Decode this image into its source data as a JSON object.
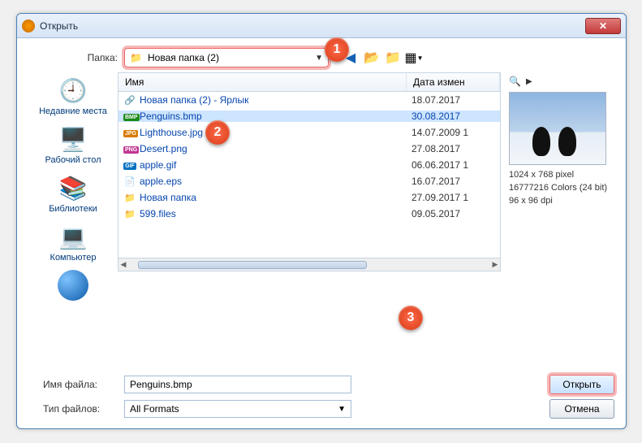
{
  "window": {
    "title": "Открыть"
  },
  "folder": {
    "label": "Папка:",
    "value": "Новая папка (2)"
  },
  "nav_icons": {
    "back": "back-icon",
    "up": "up-icon",
    "newfolder": "new-folder-icon",
    "views": "views-icon"
  },
  "places": [
    {
      "label": "Недавние места",
      "key": "recent"
    },
    {
      "label": "Рабочий стол",
      "key": "desktop"
    },
    {
      "label": "Библиотеки",
      "key": "libraries"
    },
    {
      "label": "Компьютер",
      "key": "computer"
    },
    {
      "label": "",
      "key": "network"
    }
  ],
  "columns": {
    "name": "Имя",
    "date": "Дата измен"
  },
  "files": [
    {
      "name": "Новая папка (2) - Ярлык",
      "date": "18.07.2017",
      "icon": "🔗",
      "tag": null
    },
    {
      "name": "Penguins.bmp",
      "date": "30.08.2017",
      "icon": null,
      "tag": "BMP",
      "tagColor": "#1a8a1a",
      "selected": true
    },
    {
      "name": "Lighthouse.jpg",
      "date": "14.07.2009 1",
      "icon": null,
      "tag": "JPG",
      "tagColor": "#d97a00"
    },
    {
      "name": "Desert.png",
      "date": "27.08.2017",
      "icon": null,
      "tag": "PNG",
      "tagColor": "#c03792"
    },
    {
      "name": "apple.gif",
      "date": "06.06.2017 1",
      "icon": null,
      "tag": "GIF",
      "tagColor": "#0070c0"
    },
    {
      "name": "apple.eps",
      "date": "16.07.2017",
      "icon": "📄",
      "tag": null
    },
    {
      "name": "Новая папка",
      "date": "27.09.2017 1",
      "icon": "📁",
      "tag": null
    },
    {
      "name": "599.files",
      "date": "09.05.2017",
      "icon": "📁",
      "tag": null
    }
  ],
  "preview": {
    "dimensions": "1024 x 768 pixel",
    "colors": "16777216 Colors (24 bit)",
    "dpi": "96 x 96 dpi"
  },
  "filename": {
    "label": "Имя файла:",
    "value": "Penguins.bmp"
  },
  "filetype": {
    "label": "Тип файлов:",
    "value": "All Formats"
  },
  "buttons": {
    "open": "Открыть",
    "cancel": "Отмена"
  },
  "badges": [
    "1",
    "2",
    "3"
  ]
}
